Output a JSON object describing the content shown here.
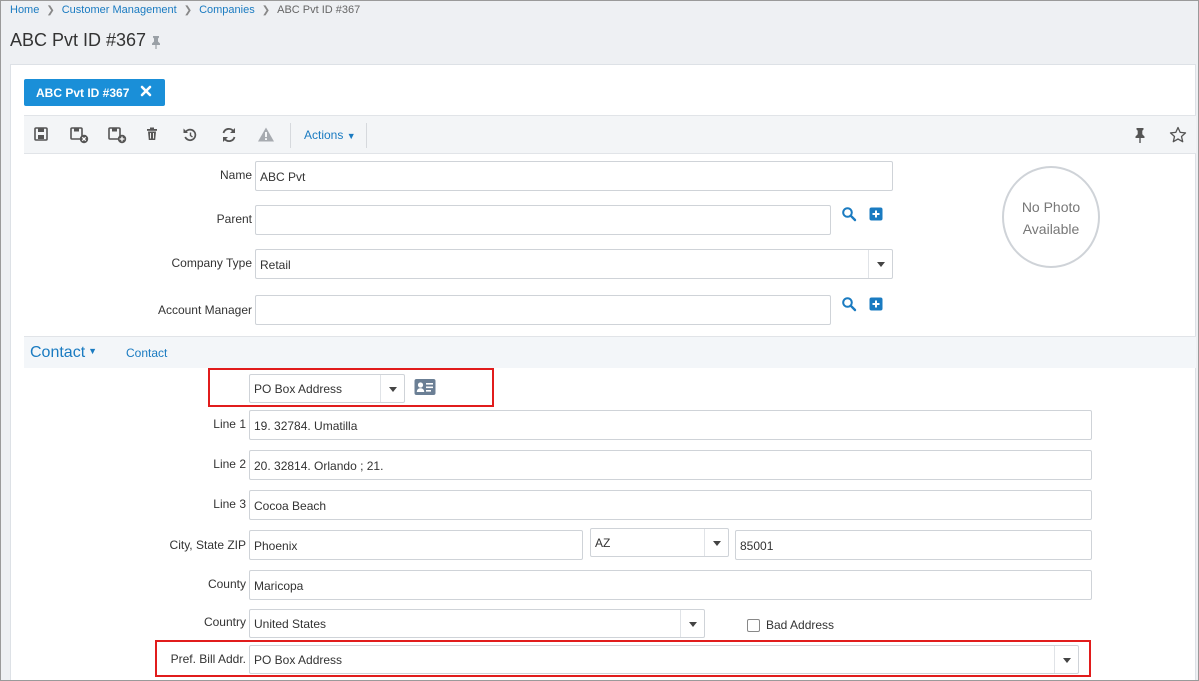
{
  "breadcrumb": {
    "items": [
      "Home",
      "Customer Management",
      "Companies"
    ],
    "current": "ABC Pvt ID #367"
  },
  "page": {
    "title": "ABC Pvt ID #367"
  },
  "record_tab": {
    "label": "ABC Pvt ID #367"
  },
  "toolbar": {
    "actions_label": "Actions",
    "icons": [
      "save-icon",
      "save-and-close-icon",
      "save-and-new-icon",
      "delete-icon",
      "undo-icon",
      "refresh-icon",
      "warning-icon",
      "pin-icon",
      "star-icon"
    ]
  },
  "form": {
    "name_label": "Name",
    "name_value": "ABC Pvt",
    "parent_label": "Parent",
    "parent_value": "",
    "company_type_label": "Company Type",
    "company_type_value": "Retail",
    "account_manager_label": "Account Manager",
    "account_manager_value": ""
  },
  "photo": {
    "line1": "No Photo",
    "line2": "Available"
  },
  "contact": {
    "section_title": "Contact",
    "section_link": "Contact",
    "address_type_value": "PO Box Address",
    "line1_label": "Line 1",
    "line1_value": "19. 32784. Umatilla",
    "line2_label": "Line 2",
    "line2_value": "20. 32814. Orlando ; 21.",
    "line3_label": "Line 3",
    "line3_value": "Cocoa Beach",
    "city_state_zip_label": "City, State ZIP",
    "city_value": "Phoenix",
    "state_value": "AZ",
    "zip_value": "85001",
    "county_label": "County",
    "county_value": "Maricopa",
    "country_label": "Country",
    "country_value": "United States",
    "bad_address_label": "Bad Address",
    "bad_address_checked": false,
    "pref_bill_label": "Pref. Bill Addr.",
    "pref_bill_value": "PO Box Address"
  },
  "colors": {
    "accent": "#1a8fd8",
    "link": "#1a7bc1",
    "highlight": "#e11c1c"
  }
}
